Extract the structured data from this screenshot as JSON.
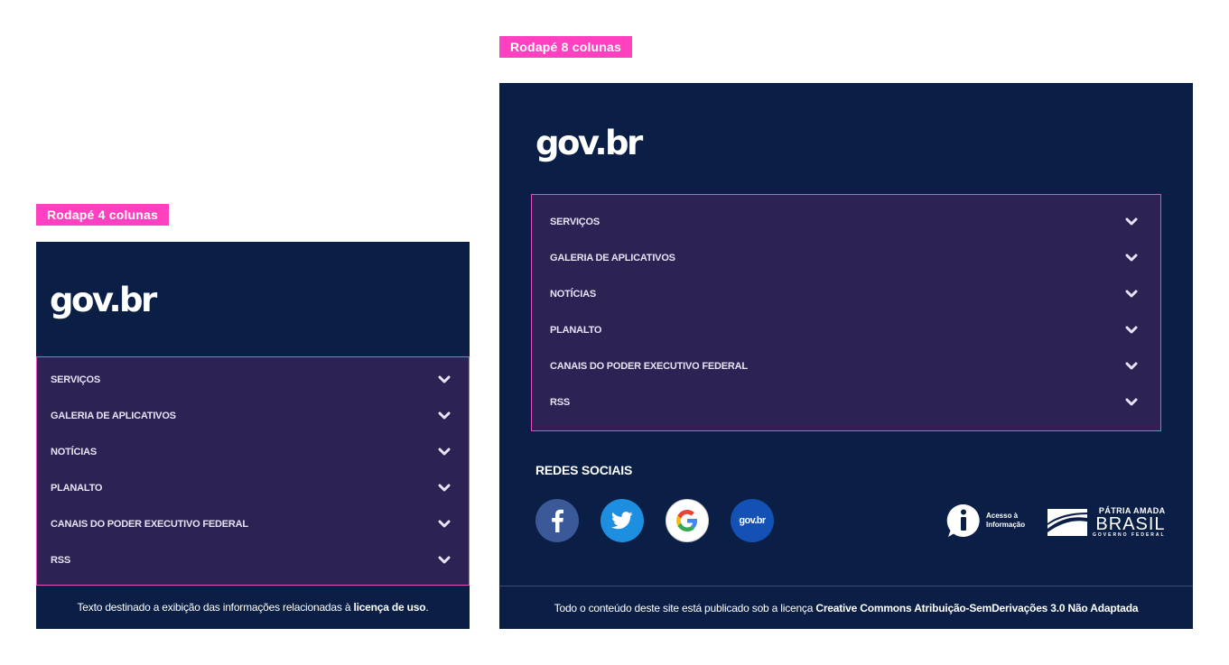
{
  "brand": {
    "logo_text": "gov.br"
  },
  "colors": {
    "footer_bg": "#0a1e46",
    "menu_bg": "#2d2253",
    "highlight_pink": "#ff40c0",
    "facebook": "#3b5998",
    "twitter": "#1d9bf0",
    "google": "#ffffff",
    "govbr_blue": "#1351b4"
  },
  "footer4": {
    "tag": "Rodapé  4 colunas",
    "menu": [
      {
        "label": "SERVIÇOS",
        "icon": "chevron-down-icon"
      },
      {
        "label": "GALERIA DE APLICATIVOS",
        "icon": "chevron-down-icon"
      },
      {
        "label": "NOTÍCIAS",
        "icon": "chevron-down-icon"
      },
      {
        "label": "PLANALTO",
        "icon": "chevron-down-icon"
      },
      {
        "label": "CANAIS DO PODER EXECUTIVO FEDERAL",
        "icon": "chevron-down-icon"
      },
      {
        "label": "RSS",
        "icon": "chevron-down-icon"
      }
    ],
    "bottom_text": "Texto destinado a exibição das informações relacionadas à ",
    "bottom_link": "licença de uso",
    "bottom_suffix": "."
  },
  "footer8": {
    "tag": "Rodapé  8 colunas",
    "menu": [
      {
        "label": "SERVIÇOS",
        "icon": "chevron-down-icon"
      },
      {
        "label": "GALERIA DE APLICATIVOS",
        "icon": "chevron-down-icon"
      },
      {
        "label": "NOTÍCIAS",
        "icon": "chevron-down-icon"
      },
      {
        "label": "PLANALTO",
        "icon": "chevron-down-icon"
      },
      {
        "label": "CANAIS DO PODER EXECUTIVO FEDERAL",
        "icon": "chevron-down-icon"
      },
      {
        "label": "RSS",
        "icon": "chevron-down-icon"
      }
    ],
    "social_title": "REDES SOCIAIS",
    "social": [
      {
        "name": "Facebook",
        "icon": "facebook-icon"
      },
      {
        "name": "Twitter",
        "icon": "twitter-icon"
      },
      {
        "name": "Google",
        "icon": "google-icon"
      },
      {
        "name": "gov.br",
        "icon": "govbr-icon",
        "label": "gov.br"
      }
    ],
    "acesso_line1": "Acesso à",
    "acesso_line2": "Informação",
    "patria_line1": "PÁTRIA AMADA",
    "patria_line2": "BRASIL",
    "patria_line3": "GOVERNO FEDERAL",
    "bottom_text": "Todo o conteúdo deste site está publicado sob a licença ",
    "bottom_link": "Creative Commons Atribuição-SemDerivações 3.0 Não Adaptada"
  }
}
